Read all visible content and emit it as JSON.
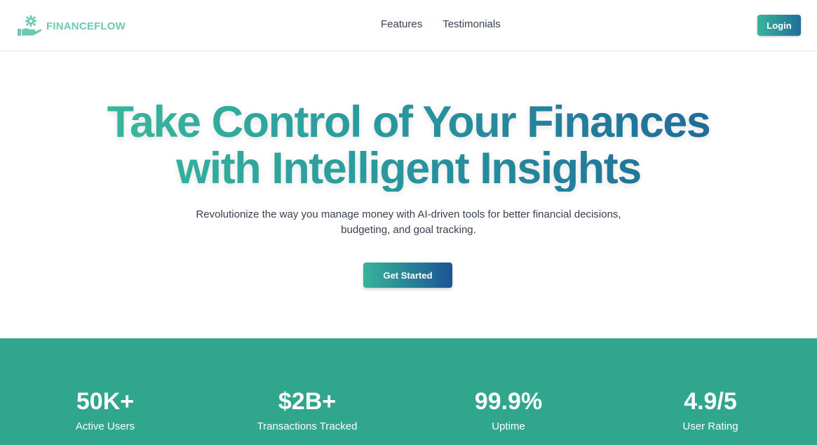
{
  "brand": {
    "name": "FINANCEFLOW",
    "logo_icon": "hand-gear-icon"
  },
  "nav": {
    "links": [
      {
        "label": "Features"
      },
      {
        "label": "Testimonials"
      }
    ],
    "login_label": "Login"
  },
  "hero": {
    "title_line1": "Take Control of Your Finances",
    "title_line2": "with Intelligent Insights",
    "subtitle_line1": "Revolutionize the way you manage money with AI-driven tools for better financial decisions,",
    "subtitle_line2": "budgeting, and goal tracking.",
    "cta_label": "Get Started"
  },
  "stats": [
    {
      "value": "50K+",
      "label": "Active Users"
    },
    {
      "value": "$2B+",
      "label": "Transactions Tracked"
    },
    {
      "value": "99.9%",
      "label": "Uptime"
    },
    {
      "value": "4.9/5",
      "label": "User Rating"
    }
  ],
  "colors": {
    "brand_teal": "#6cc9b2",
    "gradient_start": "#3ec39b",
    "gradient_end": "#1b5e98",
    "stats_background": "#30a68d"
  }
}
